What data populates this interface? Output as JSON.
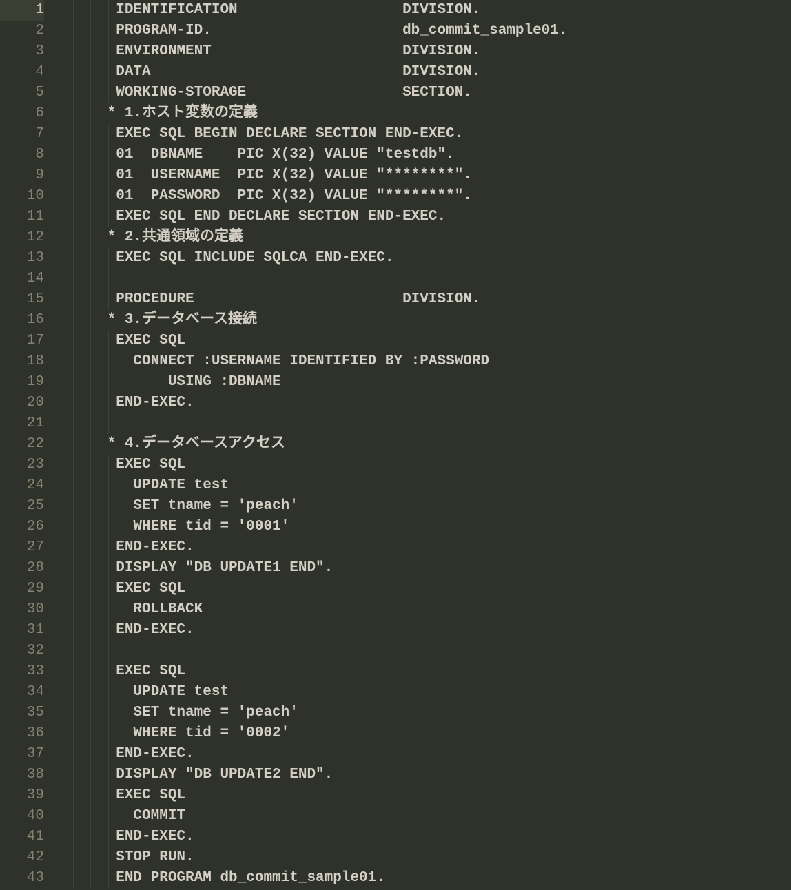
{
  "editor": {
    "active_line": 1,
    "lines": [
      "       IDENTIFICATION                   DIVISION.",
      "       PROGRAM-ID.                      db_commit_sample01.",
      "       ENVIRONMENT                      DIVISION.",
      "       DATA                             DIVISION.",
      "       WORKING-STORAGE                  SECTION.",
      "      * 1.ホスト変数の定義",
      "       EXEC SQL BEGIN DECLARE SECTION END-EXEC.",
      "       01  DBNAME    PIC X(32) VALUE \"testdb\".",
      "       01  USERNAME  PIC X(32) VALUE \"********\".",
      "       01  PASSWORD  PIC X(32) VALUE \"********\".",
      "       EXEC SQL END DECLARE SECTION END-EXEC.",
      "      * 2.共通領域の定義",
      "       EXEC SQL INCLUDE SQLCA END-EXEC.",
      "",
      "       PROCEDURE                        DIVISION.",
      "      * 3.データベース接続",
      "       EXEC SQL",
      "         CONNECT :USERNAME IDENTIFIED BY :PASSWORD",
      "             USING :DBNAME",
      "       END-EXEC.",
      "",
      "      * 4.データベースアクセス",
      "       EXEC SQL",
      "         UPDATE test",
      "         SET tname = 'peach'",
      "         WHERE tid = '0001'",
      "       END-EXEC.",
      "       DISPLAY \"DB UPDATE1 END\".",
      "       EXEC SQL",
      "         ROLLBACK",
      "       END-EXEC.",
      "",
      "       EXEC SQL",
      "         UPDATE test",
      "         SET tname = 'peach'",
      "         WHERE tid = '0002'",
      "       END-EXEC.",
      "       DISPLAY \"DB UPDATE2 END\".",
      "       EXEC SQL",
      "         COMMIT",
      "       END-EXEC.",
      "       STOP RUN.",
      "       END PROGRAM db_commit_sample01."
    ],
    "line_numbers": [
      "1",
      "2",
      "3",
      "4",
      "5",
      "6",
      "7",
      "8",
      "9",
      "10",
      "11",
      "12",
      "13",
      "14",
      "15",
      "16",
      "17",
      "18",
      "19",
      "20",
      "21",
      "22",
      "23",
      "24",
      "25",
      "26",
      "27",
      "28",
      "29",
      "30",
      "31",
      "32",
      "33",
      "34",
      "35",
      "36",
      "37",
      "38",
      "39",
      "40",
      "41",
      "42",
      "43"
    ]
  }
}
